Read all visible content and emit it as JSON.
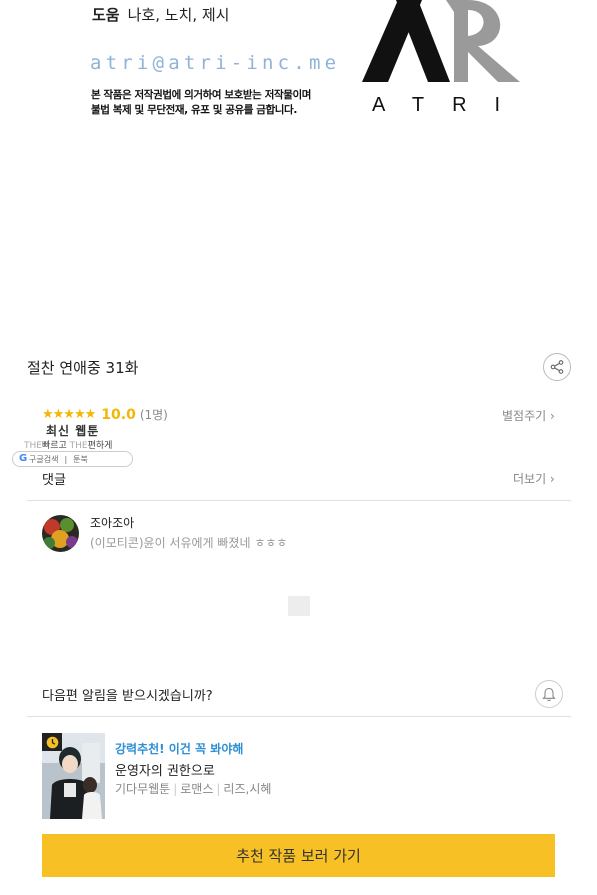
{
  "credits": {
    "role_label": "도움",
    "names": "나호, 노치, 제시",
    "email": "atri@atri-inc.me",
    "notice_line1": "본 작품은 저작권법에 의거하여 보호받는 저작물이며",
    "notice_line2": "불법 복제 및 무단전재, 유포 및 공유를 금합니다.",
    "logo_text": "ATRI"
  },
  "series": {
    "title": "절찬 연애중 31화",
    "share_icon": "share-icon"
  },
  "rating": {
    "stars": "★★★★★",
    "stars_value": 5,
    "score": "10.0",
    "count": "(1명)",
    "rate_link": "별점주기 ›"
  },
  "ad": {
    "title": "최신 웹툰",
    "sub_left_ghost": "THE",
    "sub_left": "빠르고",
    "sub_right_ghost": "THE",
    "sub_right": "편하게",
    "pill_left": "구글검색",
    "pill_right": "툰북"
  },
  "comments": {
    "label": "댓글",
    "more": "더보기 ›",
    "items": [
      {
        "user": "조아조아",
        "text": "(이모티콘)윤이 서유에게 빠졌네 ㅎㅎㅎ"
      }
    ]
  },
  "notify": {
    "text": "다음편 알림을 받으시겠습니까?",
    "icon": "bell-icon"
  },
  "recommend": {
    "tag": "강력추천! 이건 꼭 봐야해",
    "title": "운영자의 권한으로",
    "meta": [
      "기다무웹툰",
      "로맨스",
      "리즈,시혜"
    ],
    "cta": "추천 작품 보러 가기"
  },
  "colors": {
    "accent_yellow": "#f7c126",
    "star": "#f2b705",
    "link_blue": "#2d8fd5",
    "email_blue": "#8fb3d9"
  }
}
